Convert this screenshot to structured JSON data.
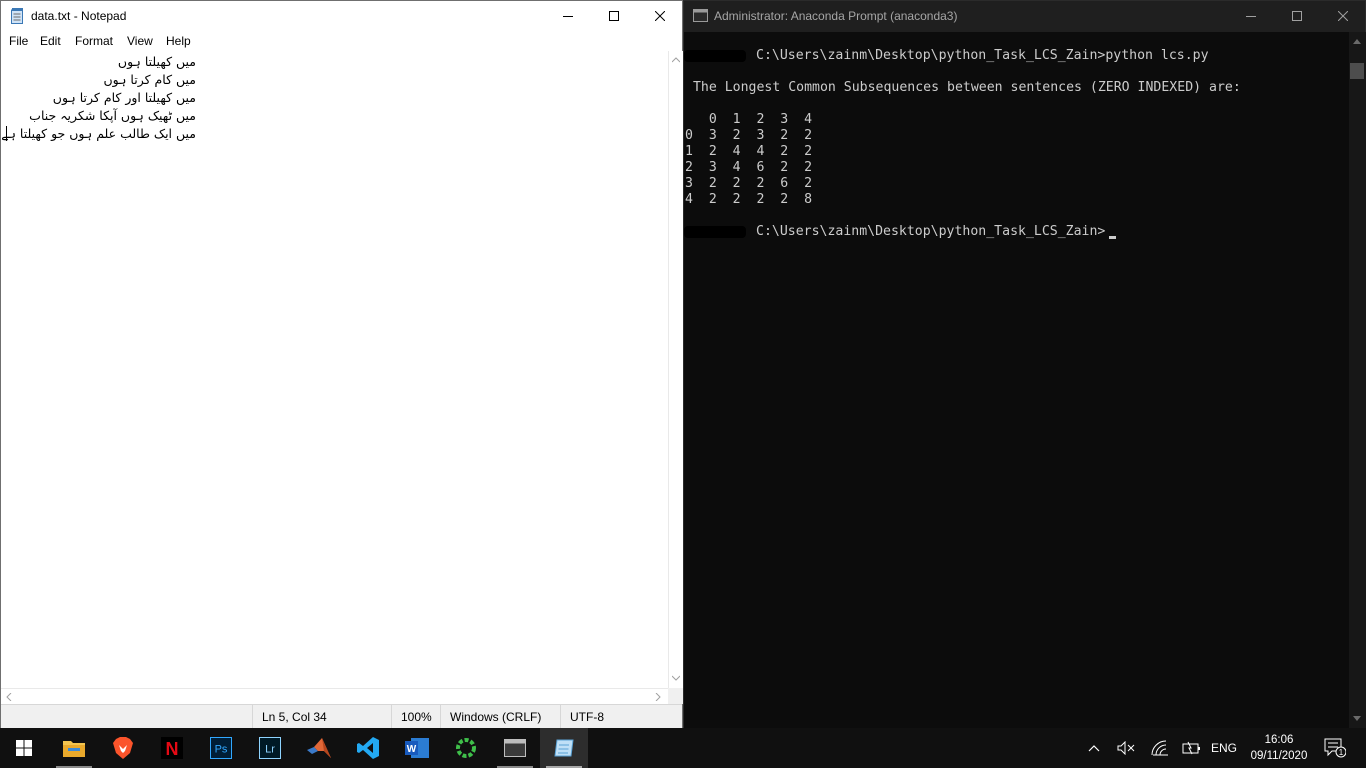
{
  "notepad": {
    "title": "data.txt - Notepad",
    "menu": [
      "File",
      "Edit",
      "Format",
      "View",
      "Help"
    ],
    "lines": [
      "میں کھیلتا ہوں",
      "میں کام کرتا ہوں",
      "میں کھیلتا اور کام کرتا ہوں",
      "میں ٹھیک ہوں آپکا شکریہ جناب",
      "میں ایک طالب علم ہوں جو کھیلتا ہے"
    ],
    "status": {
      "position": "Ln 5, Col 34",
      "zoom": "100%",
      "line_ending": "Windows (CRLF)",
      "encoding": "UTF-8"
    }
  },
  "console": {
    "title": "Administrator: Anaconda Prompt (anaconda3)",
    "prompt_path": "C:\\Users\\zainm\\Desktop\\python_Task_LCS_Zain>",
    "command": "python lcs.py",
    "message": " The Longest Common Subsequences between sentences (ZERO INDEXED) are:",
    "table_header": "   0  1  2  3  4",
    "table_rows": [
      "0  3  2  3  2  2",
      "1  2  4  4  2  2",
      "2  3  4  6  2  2",
      "3  2  2  2  6  2",
      "4  2  2  2  2  8"
    ]
  },
  "taskbar": {
    "apps": [
      "start-icon",
      "file-explorer-icon",
      "brave-icon",
      "netflix-icon",
      "photoshop-icon",
      "lightroom-icon",
      "matlab-icon",
      "vscode-icon",
      "word-icon",
      "spinner-app-icon",
      "console-app-icon",
      "notepad-app-icon"
    ],
    "photoshop_label": "Ps",
    "lightroom_label": "Lr",
    "netflix_label": "N",
    "word_label": "W",
    "language": "ENG",
    "time": "16:06",
    "date": "09/11/2020",
    "notification_count": "1"
  }
}
